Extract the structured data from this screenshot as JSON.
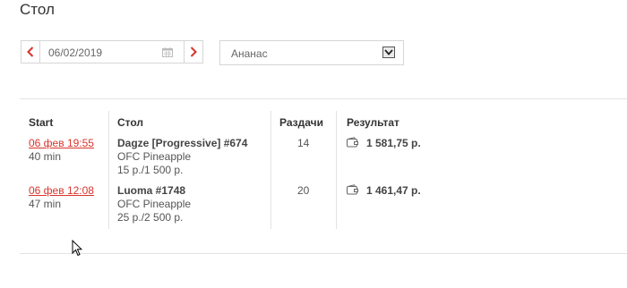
{
  "page": {
    "title": "Стол"
  },
  "filters": {
    "date_value": "06/02/2019",
    "select_value": "Ананас"
  },
  "table": {
    "headers": {
      "start": "Start",
      "table": "Стол",
      "hands": "Раздачи",
      "result": "Результат"
    },
    "rows": [
      {
        "start": "06 фев 19:55",
        "duration": "40 min",
        "table_name": "Dagze [Progressive] #674",
        "game": "OFC Pineapple",
        "stakes": "15 р./1 500 р.",
        "hands": "14",
        "result": "1 581,75 р."
      },
      {
        "start": "06 фев 12:08",
        "duration": "47 min",
        "table_name": "Luoma #1748",
        "game": "OFC Pineapple",
        "stakes": "25 р./2 500 р.",
        "hands": "20",
        "result": "1 461,47 р."
      }
    ]
  },
  "colors": {
    "accent": "#d9342b",
    "border": "#d6d6d6",
    "text": "#444444"
  },
  "icons": [
    "chevron-left-icon",
    "chevron-right-icon",
    "calendar-icon",
    "dropdown-arrow-icon",
    "wallet-icon",
    "mouse-cursor-icon"
  ]
}
